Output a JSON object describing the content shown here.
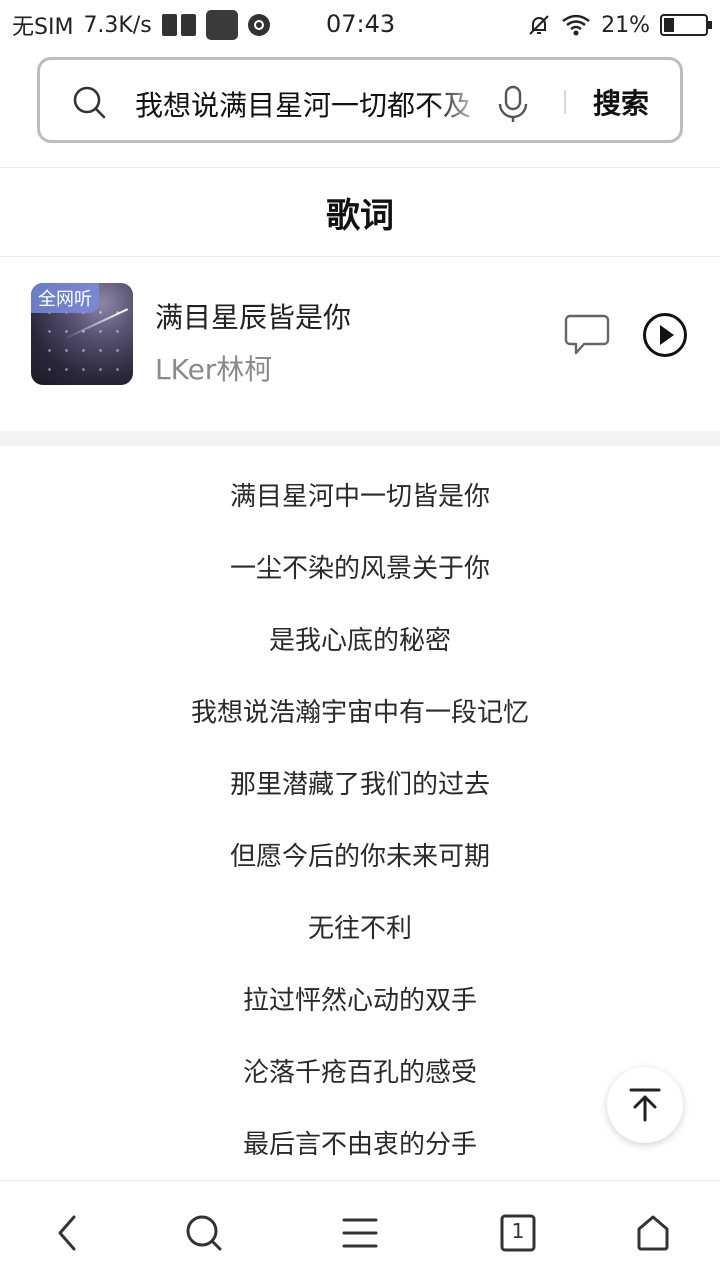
{
  "status_bar": {
    "carrier": "无SIM",
    "speed": "7.3K/s",
    "time": "07:43",
    "battery": "21%"
  },
  "search": {
    "query": "我想说满目星河一切都不及",
    "button_label": "搜索"
  },
  "section_title": "歌词",
  "song": {
    "badge": "全网听",
    "title": "满目星辰皆是你",
    "artist": "LKer林柯"
  },
  "lyrics": [
    "满目星河中一切皆是你",
    "一尘不染的风景关于你",
    "是我心底的秘密",
    "我想说浩瀚宇宙中有一段记忆",
    "那里潜藏了我们的过去",
    "但愿今后的你未来可期",
    "无往不利",
    "拉过怦然心动的双手",
    "沦落千疮百孔的感受",
    "最后言不由衷的分手"
  ],
  "bottom_nav": {
    "tab_count": "1"
  },
  "icons": {
    "status": [
      "reader-icon",
      "app-icon",
      "media-icon",
      "mute-icon",
      "wifi-icon",
      "battery-icon"
    ],
    "search": [
      "search-icon",
      "mic-icon"
    ],
    "song": [
      "comment-icon",
      "play-icon"
    ],
    "nav": [
      "back-icon",
      "search-icon",
      "menu-icon",
      "tabs-icon",
      "home-icon"
    ],
    "floating": "back-to-top-icon"
  },
  "colors": {
    "text_primary": "#1a1a1a",
    "text_secondary": "#8a8a8a",
    "badge": "#788cdc",
    "divider": "#ececec",
    "band": "#f3f3f3"
  }
}
